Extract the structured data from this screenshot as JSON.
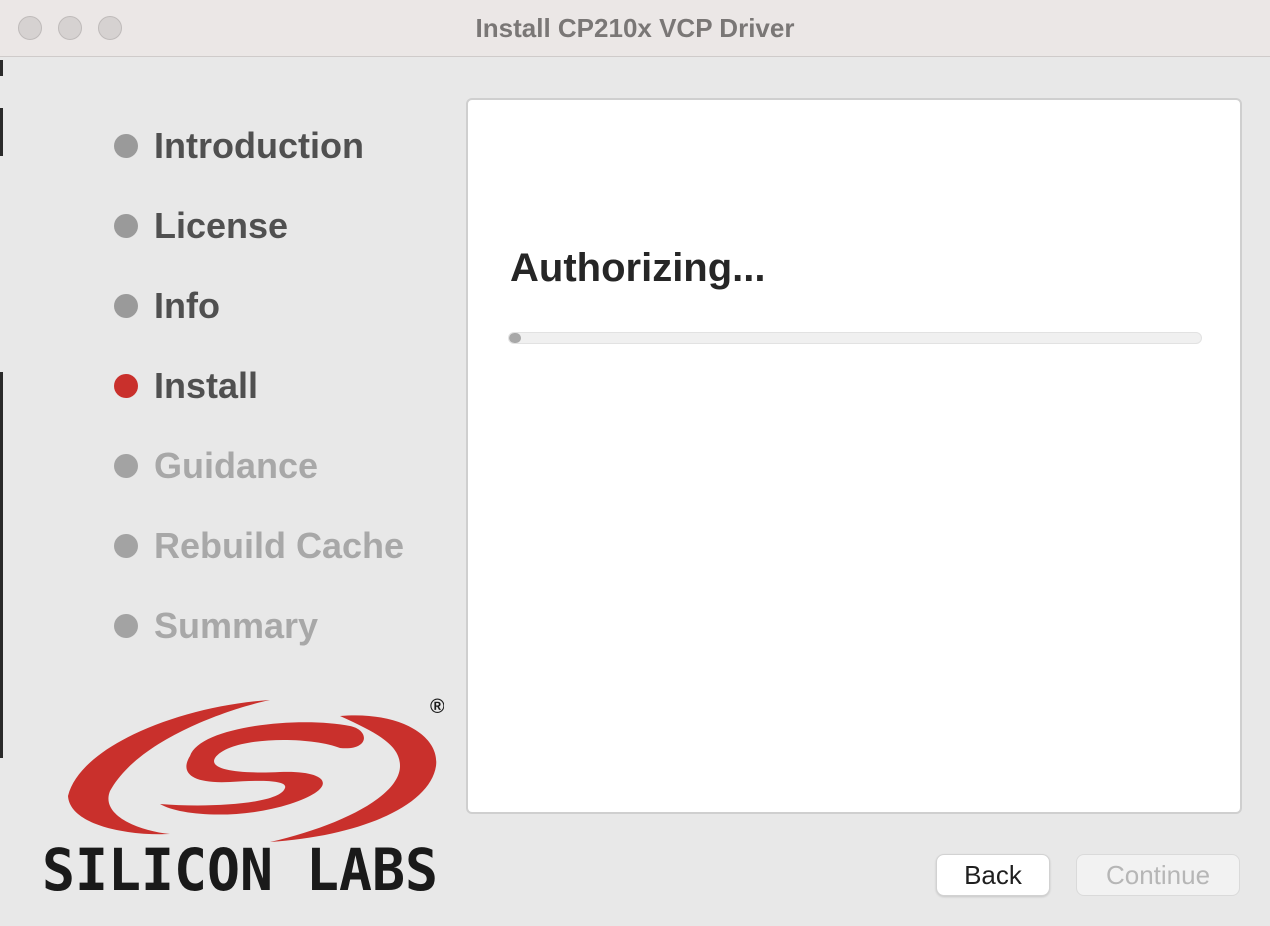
{
  "window": {
    "title": "Install CP210x VCP Driver",
    "controls": [
      "close-icon",
      "minimize-icon",
      "zoom-icon"
    ]
  },
  "sidebar": {
    "steps": [
      {
        "label": "Introduction",
        "state": "completed"
      },
      {
        "label": "License",
        "state": "completed"
      },
      {
        "label": "Info",
        "state": "completed"
      },
      {
        "label": "Install",
        "state": "current"
      },
      {
        "label": "Guidance",
        "state": "pending"
      },
      {
        "label": "Rebuild Cache",
        "state": "pending"
      },
      {
        "label": "Summary",
        "state": "pending"
      }
    ],
    "logo": {
      "text": "SILICON LABS",
      "mark": "®",
      "color": "#c9302c"
    }
  },
  "main": {
    "status": "Authorizing...",
    "progress": 0.01
  },
  "buttons": {
    "back": "Back",
    "continue": "Continue",
    "continue_enabled": false
  },
  "colors": {
    "accent": "#c9302c",
    "completed_dot": "#9a9a9a",
    "pending_dot": "#a3a3a3"
  }
}
